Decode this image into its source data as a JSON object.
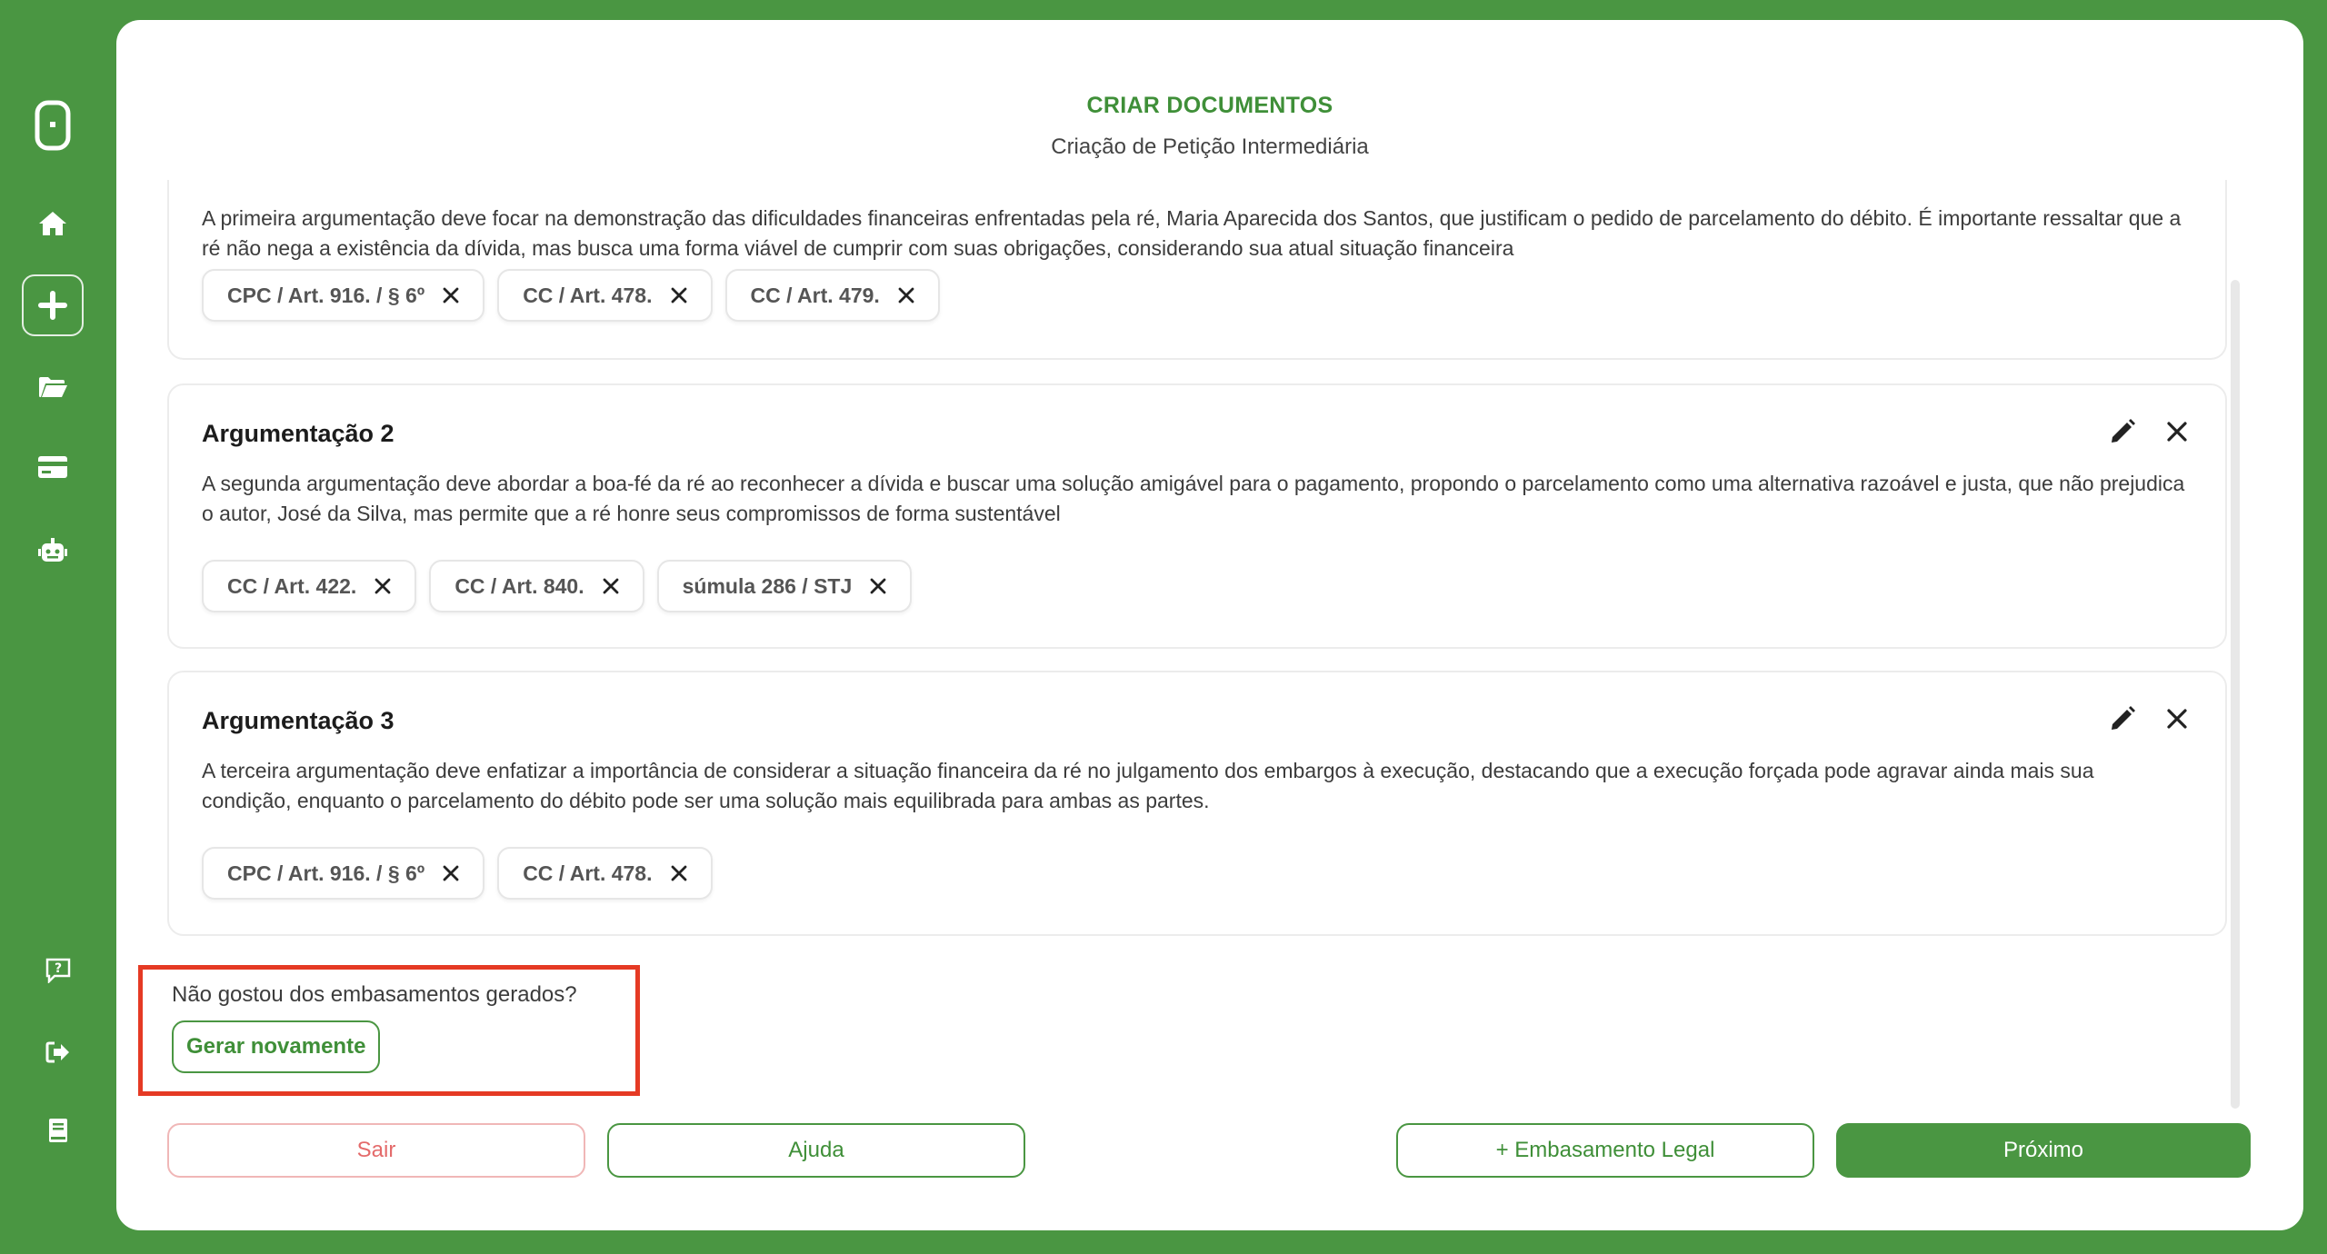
{
  "header": {
    "title": "CRIAR DOCUMENTOS",
    "subtitle": "Criação de Petição Intermediária"
  },
  "sidebar": {
    "icons": [
      "logo-icon",
      "home-icon",
      "plus-icon",
      "folder-icon",
      "credit-card-icon",
      "robot-icon",
      "help-icon",
      "logout-icon",
      "book-icon"
    ]
  },
  "arguments": [
    {
      "title": "",
      "text": "A primeira argumentação deve focar na demonstração das dificuldades financeiras enfrentadas pela ré, Maria Aparecida dos Santos, que justificam o pedido de parcelamento do débito. É importante ressaltar que a ré não nega a existência da dívida, mas busca uma forma viável de cumprir com suas obrigações, considerando sua atual situação financeira",
      "tags": [
        "CPC / Art. 916. / § 6º",
        "CC / Art. 478.",
        "CC / Art. 479."
      ]
    },
    {
      "title": "Argumentação 2",
      "text": "A segunda argumentação deve abordar a boa-fé da ré ao reconhecer a dívida e buscar uma solução amigável para o pagamento, propondo o parcelamento como uma alternativa razoável e justa, que não prejudica o autor, José da Silva, mas permite que a ré honre seus compromissos de forma sustentável",
      "tags": [
        "CC / Art. 422.",
        "CC / Art. 840.",
        "súmula 286 / STJ"
      ]
    },
    {
      "title": "Argumentação 3",
      "text": "A terceira argumentação deve enfatizar a importância de considerar a situação financeira da ré no julgamento dos embargos à execução, destacando que a execução forçada pode agravar ainda mais sua condição, enquanto o parcelamento do débito pode ser uma solução mais equilibrada para ambas as partes.",
      "tags": [
        "CPC / Art. 916. / § 6º",
        "CC / Art. 478."
      ]
    }
  ],
  "regenerate": {
    "question": "Não gostou dos embasamentos gerados?",
    "button": "Gerar novamente"
  },
  "footer": {
    "exit": "Sair",
    "help": "Ajuda",
    "add_basis": "+ Embasamento Legal",
    "next": "Próximo"
  },
  "colors": {
    "brand_green": "#4a9642",
    "highlight_red": "#e53a24",
    "exit_red": "#e46a6a"
  }
}
